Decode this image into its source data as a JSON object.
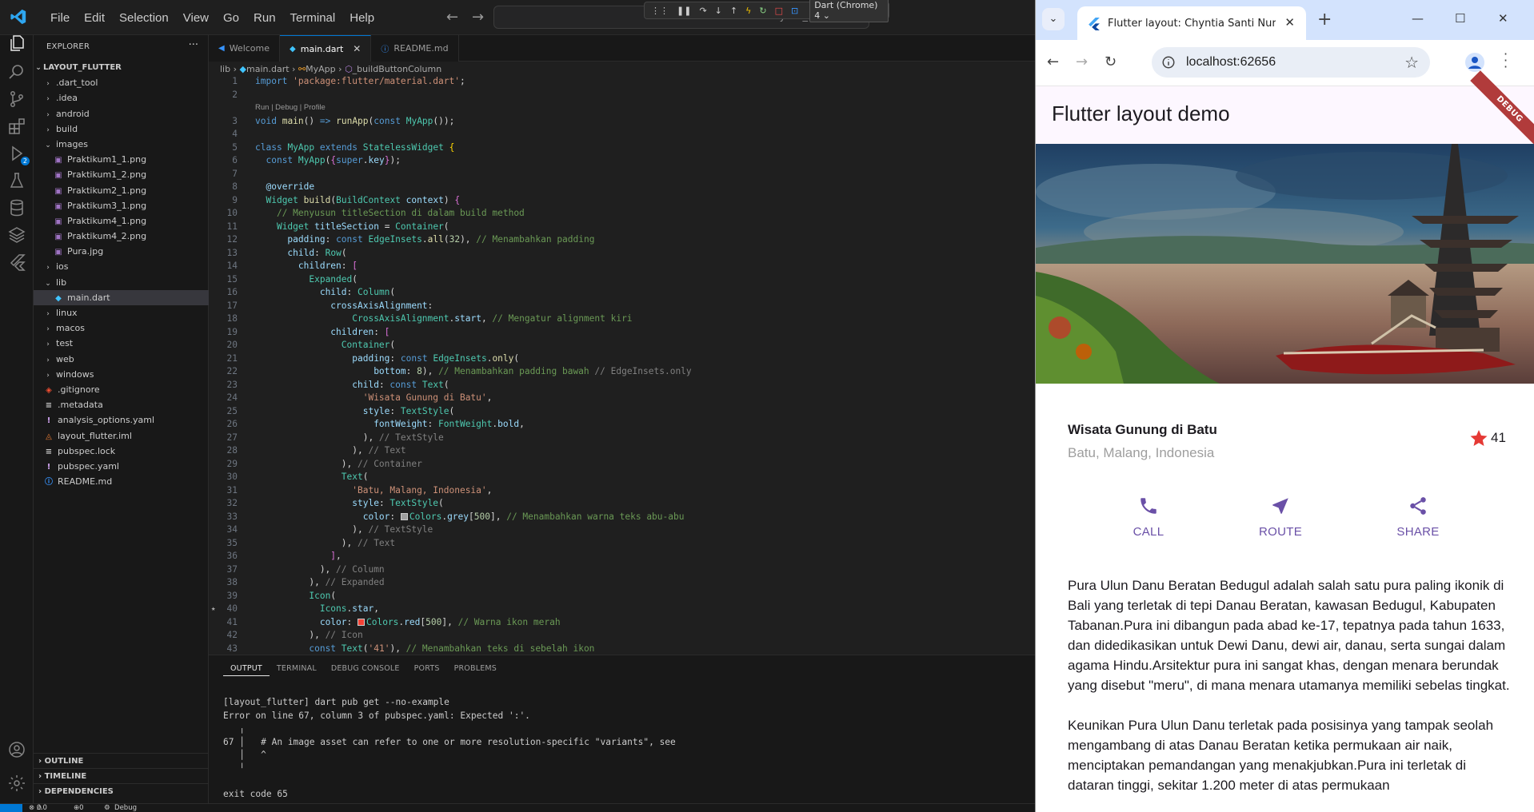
{
  "vscode": {
    "menu": [
      "File",
      "Edit",
      "Selection",
      "View",
      "Go",
      "Run",
      "Terminal",
      "Help"
    ],
    "command_center": "layout_flutter",
    "debug_target": "Dart (Chrome) 4",
    "explorer": {
      "title": "EXPLORER",
      "root": "LAYOUT_FLUTTER",
      "items": [
        {
          "label": ".dart_tool",
          "kind": "folder",
          "depth": 1
        },
        {
          "label": ".idea",
          "kind": "folder",
          "depth": 1
        },
        {
          "label": "android",
          "kind": "folder",
          "depth": 1
        },
        {
          "label": "build",
          "kind": "folder",
          "depth": 1
        },
        {
          "label": "images",
          "kind": "folder-open",
          "depth": 1
        },
        {
          "label": "Praktikum1_1.png",
          "kind": "image",
          "depth": 2
        },
        {
          "label": "Praktikum1_2.png",
          "kind": "image",
          "depth": 2
        },
        {
          "label": "Praktikum2_1.png",
          "kind": "image",
          "depth": 2
        },
        {
          "label": "Praktikum3_1.png",
          "kind": "image",
          "depth": 2
        },
        {
          "label": "Praktikum4_1.png",
          "kind": "image",
          "depth": 2
        },
        {
          "label": "Praktikum4_2.png",
          "kind": "image",
          "depth": 2
        },
        {
          "label": "Pura.jpg",
          "kind": "image",
          "depth": 2
        },
        {
          "label": "ios",
          "kind": "folder",
          "depth": 1
        },
        {
          "label": "lib",
          "kind": "folder-open",
          "depth": 1
        },
        {
          "label": "main.dart",
          "kind": "dart",
          "depth": 2,
          "selected": true
        },
        {
          "label": "linux",
          "kind": "folder",
          "depth": 1
        },
        {
          "label": "macos",
          "kind": "folder",
          "depth": 1
        },
        {
          "label": "test",
          "kind": "folder",
          "depth": 1
        },
        {
          "label": "web",
          "kind": "folder",
          "depth": 1
        },
        {
          "label": "windows",
          "kind": "folder",
          "depth": 1
        },
        {
          "label": ".gitignore",
          "kind": "git",
          "depth": 1
        },
        {
          "label": ".metadata",
          "kind": "file",
          "depth": 1
        },
        {
          "label": "analysis_options.yaml",
          "kind": "yaml",
          "depth": 1
        },
        {
          "label": "layout_flutter.iml",
          "kind": "iml",
          "depth": 1
        },
        {
          "label": "pubspec.lock",
          "kind": "file",
          "depth": 1
        },
        {
          "label": "pubspec.yaml",
          "kind": "yaml",
          "depth": 1
        },
        {
          "label": "README.md",
          "kind": "info",
          "depth": 1
        }
      ],
      "footer": [
        "OUTLINE",
        "TIMELINE",
        "DEPENDENCIES"
      ]
    },
    "tabs": [
      {
        "label": "Welcome",
        "active": false
      },
      {
        "label": "main.dart",
        "active": true
      },
      {
        "label": "README.md",
        "active": false
      }
    ],
    "breadcrumb": [
      "lib",
      "main.dart",
      "MyApp",
      "_buildButtonColumn"
    ],
    "code_lens": "Run | Debug | Profile",
    "code": [
      {
        "n": "1",
        "html": "<span class='k'>import</span> <span class='s'>'package:flutter/material.dart'</span>;"
      },
      {
        "n": "2",
        "html": ""
      },
      {
        "n": "",
        "lens": true
      },
      {
        "n": "3",
        "html": "<span class='k'>void</span> <span class='f'>main</span>() <span class='k'>=&gt;</span> <span class='f'>runApp</span>(<span class='k'>const</span> <span class='c'>MyApp</span>());"
      },
      {
        "n": "4",
        "html": ""
      },
      {
        "n": "5",
        "html": "<span class='k'>class</span> <span class='c'>MyApp</span> <span class='k'>extends</span> <span class='c'>StatelessWidget</span> <span class='y'>{</span>"
      },
      {
        "n": "6",
        "html": "  <span class='k'>const</span> <span class='c'>MyApp</span>(<span class='p'>{</span><span class='k'>super</span>.<span class='v'>key</span><span class='p'>}</span>);"
      },
      {
        "n": "7",
        "html": ""
      },
      {
        "n": "8",
        "html": "  <span class='v'>@override</span>"
      },
      {
        "n": "9",
        "html": "  <span class='c'>Widget</span> <span class='f'>build</span>(<span class='c'>BuildContext</span> <span class='v'>context</span>) <span class='p'>{</span>"
      },
      {
        "n": "10",
        "html": "    <span class='cm'>// Menyusun titleSection di dalam build method</span>"
      },
      {
        "n": "11",
        "html": "    <span class='c'>Widget</span> <span class='v'>titleSection</span> = <span class='c'>Container</span>("
      },
      {
        "n": "12",
        "html": "      <span class='v'>padding</span>: <span class='k'>const</span> <span class='c'>EdgeInsets</span>.<span class='f'>all</span>(<span class='n'>32</span>), <span class='cm'>// Menambahkan padding</span>"
      },
      {
        "n": "13",
        "html": "      <span class='v'>child</span>: <span class='c'>Row</span>("
      },
      {
        "n": "14",
        "html": "        <span class='v'>children</span>: <span class='p'>[</span>"
      },
      {
        "n": "15",
        "html": "          <span class='c'>Expanded</span>("
      },
      {
        "n": "16",
        "html": "            <span class='v'>child</span>: <span class='c'>Column</span>("
      },
      {
        "n": "17",
        "html": "              <span class='v'>crossAxisAlignment</span>:"
      },
      {
        "n": "18",
        "html": "                  <span class='c'>CrossAxisAlignment</span>.<span class='v'>start</span>, <span class='cm'>// Mengatur alignment kiri</span>"
      },
      {
        "n": "19",
        "html": "              <span class='v'>children</span>: <span class='p'>[</span>"
      },
      {
        "n": "20",
        "html": "                <span class='c'>Container</span>("
      },
      {
        "n": "21",
        "html": "                  <span class='v'>padding</span>: <span class='k'>const</span> <span class='c'>EdgeInsets</span>.<span class='f'>only</span>("
      },
      {
        "n": "22",
        "html": "                      <span class='v'>bottom</span>: <span class='n'>8</span>), <span class='cm'>// Menambahkan padding bawah</span> <span class='g'>// EdgeInsets.only</span>"
      },
      {
        "n": "23",
        "html": "                  <span class='v'>child</span>: <span class='k'>const</span> <span class='c'>Text</span>("
      },
      {
        "n": "24",
        "html": "                    <span class='s'>'Wisata Gunung di Batu'</span>,"
      },
      {
        "n": "25",
        "html": "                    <span class='v'>style</span>: <span class='c'>TextStyle</span>("
      },
      {
        "n": "26",
        "html": "                      <span class='v'>fontWeight</span>: <span class='c'>FontWeight</span>.<span class='v'>bold</span>,"
      },
      {
        "n": "27",
        "html": "                    ), <span class='g'>// TextStyle</span>"
      },
      {
        "n": "28",
        "html": "                  ), <span class='g'>// Text</span>"
      },
      {
        "n": "29",
        "html": "                ), <span class='g'>// Container</span>"
      },
      {
        "n": "30",
        "html": "                <span class='c'>Text</span>("
      },
      {
        "n": "31",
        "html": "                  <span class='s'>'Batu, Malang, Indonesia'</span>,"
      },
      {
        "n": "32",
        "html": "                  <span class='v'>style</span>: <span class='c'>TextStyle</span>("
      },
      {
        "n": "33",
        "html": "                    <span class='v'>color</span>: <span class='sw' style='background:#9e9e9e'></span><span class='c'>Colors</span>.<span class='v'>grey</span>[<span class='n'>500</span>], <span class='cm'>// Menambahkan warna teks abu-abu</span>"
      },
      {
        "n": "34",
        "html": "                  ), <span class='g'>// TextStyle</span>"
      },
      {
        "n": "35",
        "html": "                ), <span class='g'>// Text</span>"
      },
      {
        "n": "36",
        "html": "              <span class='p'>]</span>,"
      },
      {
        "n": "37",
        "html": "            ), <span class='g'>// Column</span>"
      },
      {
        "n": "38",
        "html": "          ), <span class='g'>// Expanded</span>"
      },
      {
        "n": "39",
        "html": "          <span class='c'>Icon</span>("
      },
      {
        "n": "40",
        "html": "            <span class='c'>Icons</span>.<span class='v'>star</span>,",
        "star": true
      },
      {
        "n": "41",
        "html": "            <span class='v'>color</span>: <span class='sw' style='background:#f44336'></span><span class='c'>Colors</span>.<span class='v'>red</span>[<span class='n'>500</span>], <span class='cm'>// Warna ikon merah</span>"
      },
      {
        "n": "42",
        "html": "          ), <span class='g'>// Icon</span>"
      },
      {
        "n": "43",
        "html": "          <span class='k'>const</span> <span class='c'>Text</span>(<span class='s'>'41'</span>), <span class='cm'>// Menambahkan teks di sebelah ikon</span>"
      }
    ],
    "panel": {
      "tabs": [
        "OUTPUT",
        "TERMINAL",
        "DEBUG CONSOLE",
        "PORTS",
        "PROBLEMS"
      ],
      "output": [
        "[layout_flutter] dart pub get --no-example",
        "Error on line 67, column 3 of pubspec.yaml: Expected ':'.",
        "   ╷",
        "67 │   # An image asset can refer to one or more resolution-specific \"variants\", see",
        "   │   ^",
        "   ╵",
        "exit code 65"
      ]
    },
    "status": {
      "errors": "0",
      "warnings": "0",
      "ports": "0",
      "task": "Debug my code"
    }
  },
  "chrome": {
    "tab_title": "Flutter layout: Chyntia Santi Nur",
    "url": "localhost:62656",
    "app": {
      "appbar_title": "Flutter layout demo",
      "debug_banner": "DEBUG",
      "title": "Wisata Gunung di Batu",
      "subtitle": "Batu, Malang, Indonesia",
      "rating": "41",
      "actions": [
        {
          "label": "CALL",
          "icon": "phone-icon"
        },
        {
          "label": "ROUTE",
          "icon": "navigation-icon"
        },
        {
          "label": "SHARE",
          "icon": "share-icon"
        }
      ],
      "description": [
        "Pura Ulun Danu Beratan Bedugul adalah salah satu pura paling ikonik di Bali yang terletak di tepi Danau Beratan, kawasan Bedugul, Kabupaten Tabanan.Pura ini dibangun pada abad ke-17, tepatnya pada tahun 1633, dan didedikasikan untuk Dewi Danu, dewi air, danau, serta sungai dalam agama Hindu.Arsitektur pura ini sangat khas, dengan menara berundak yang disebut \"meru\", di mana menara utamanya memiliki sebelas tingkat.",
        "Keunikan Pura Ulun Danu terletak pada posisinya yang tampak seolah mengambang di atas Danau Beratan ketika permukaan air naik, menciptakan pemandangan yang menakjubkan.Pura ini terletak di dataran tinggi, sekitar 1.200 meter di atas permukaan"
      ],
      "colors": {
        "accent": "#6a50a7",
        "star": "#e53935",
        "subtitle": "#9e9e9e",
        "appbar": "#fdf7ff"
      }
    }
  }
}
